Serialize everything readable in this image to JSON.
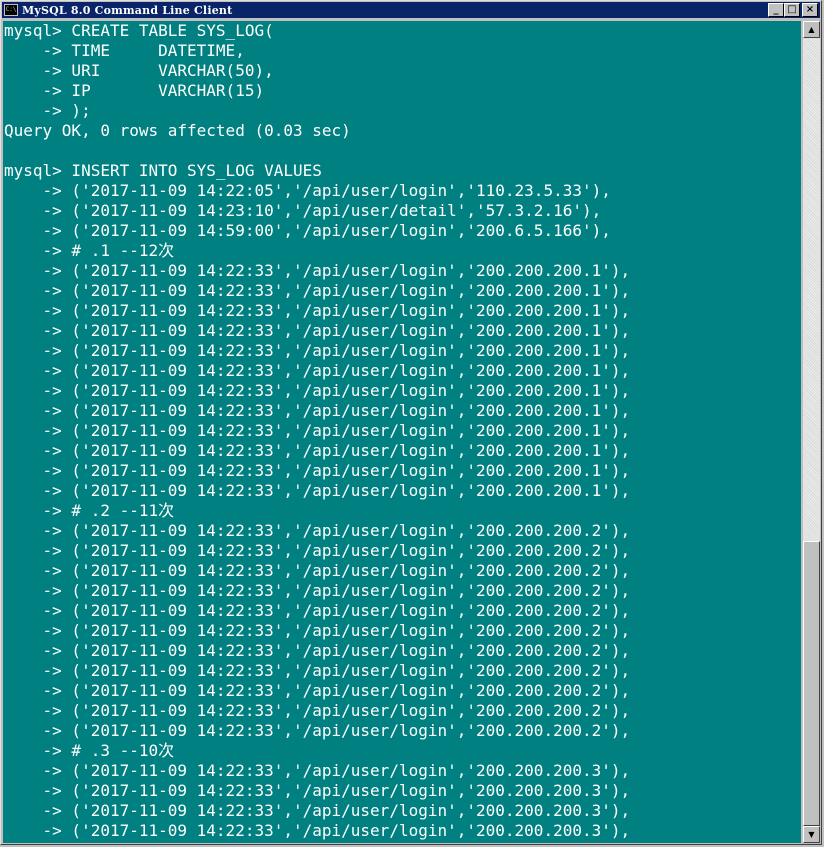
{
  "window": {
    "title": "MySQL 8.0 Command Line Client",
    "icon_label": "C:\\",
    "buttons": {
      "minimize": "_",
      "maximize": "□",
      "close": "×"
    }
  },
  "scrollbar": {
    "up_arrow": "▲",
    "down_arrow": "▼"
  },
  "colors": {
    "console_bg": "#008080",
    "text": "#ffffff",
    "titlebar": "#0a246a"
  },
  "console": {
    "lines": [
      "mysql> CREATE TABLE SYS_LOG(",
      "    -> TIME     DATETIME,",
      "    -> URI      VARCHAR(50),",
      "    -> IP       VARCHAR(15)",
      "    -> );",
      "Query OK, 0 rows affected (0.03 sec)",
      "",
      "mysql> INSERT INTO SYS_LOG VALUES",
      "    -> ('2017-11-09 14:22:05','/api/user/login','110.23.5.33'),",
      "    -> ('2017-11-09 14:23:10','/api/user/detail','57.3.2.16'),",
      "    -> ('2017-11-09 14:59:00','/api/user/login','200.6.5.166'),",
      "    -> # .1 --12次",
      "    -> ('2017-11-09 14:22:33','/api/user/login','200.200.200.1'),",
      "    -> ('2017-11-09 14:22:33','/api/user/login','200.200.200.1'),",
      "    -> ('2017-11-09 14:22:33','/api/user/login','200.200.200.1'),",
      "    -> ('2017-11-09 14:22:33','/api/user/login','200.200.200.1'),",
      "    -> ('2017-11-09 14:22:33','/api/user/login','200.200.200.1'),",
      "    -> ('2017-11-09 14:22:33','/api/user/login','200.200.200.1'),",
      "    -> ('2017-11-09 14:22:33','/api/user/login','200.200.200.1'),",
      "    -> ('2017-11-09 14:22:33','/api/user/login','200.200.200.1'),",
      "    -> ('2017-11-09 14:22:33','/api/user/login','200.200.200.1'),",
      "    -> ('2017-11-09 14:22:33','/api/user/login','200.200.200.1'),",
      "    -> ('2017-11-09 14:22:33','/api/user/login','200.200.200.1'),",
      "    -> ('2017-11-09 14:22:33','/api/user/login','200.200.200.1'),",
      "    -> # .2 --11次",
      "    -> ('2017-11-09 14:22:33','/api/user/login','200.200.200.2'),",
      "    -> ('2017-11-09 14:22:33','/api/user/login','200.200.200.2'),",
      "    -> ('2017-11-09 14:22:33','/api/user/login','200.200.200.2'),",
      "    -> ('2017-11-09 14:22:33','/api/user/login','200.200.200.2'),",
      "    -> ('2017-11-09 14:22:33','/api/user/login','200.200.200.2'),",
      "    -> ('2017-11-09 14:22:33','/api/user/login','200.200.200.2'),",
      "    -> ('2017-11-09 14:22:33','/api/user/login','200.200.200.2'),",
      "    -> ('2017-11-09 14:22:33','/api/user/login','200.200.200.2'),",
      "    -> ('2017-11-09 14:22:33','/api/user/login','200.200.200.2'),",
      "    -> ('2017-11-09 14:22:33','/api/user/login','200.200.200.2'),",
      "    -> ('2017-11-09 14:22:33','/api/user/login','200.200.200.2'),",
      "    -> # .3 --10次",
      "    -> ('2017-11-09 14:22:33','/api/user/login','200.200.200.3'),",
      "    -> ('2017-11-09 14:22:33','/api/user/login','200.200.200.3'),",
      "    -> ('2017-11-09 14:22:33','/api/user/login','200.200.200.3'),",
      "    -> ('2017-11-09 14:22:33','/api/user/login','200.200.200.3'),"
    ]
  }
}
